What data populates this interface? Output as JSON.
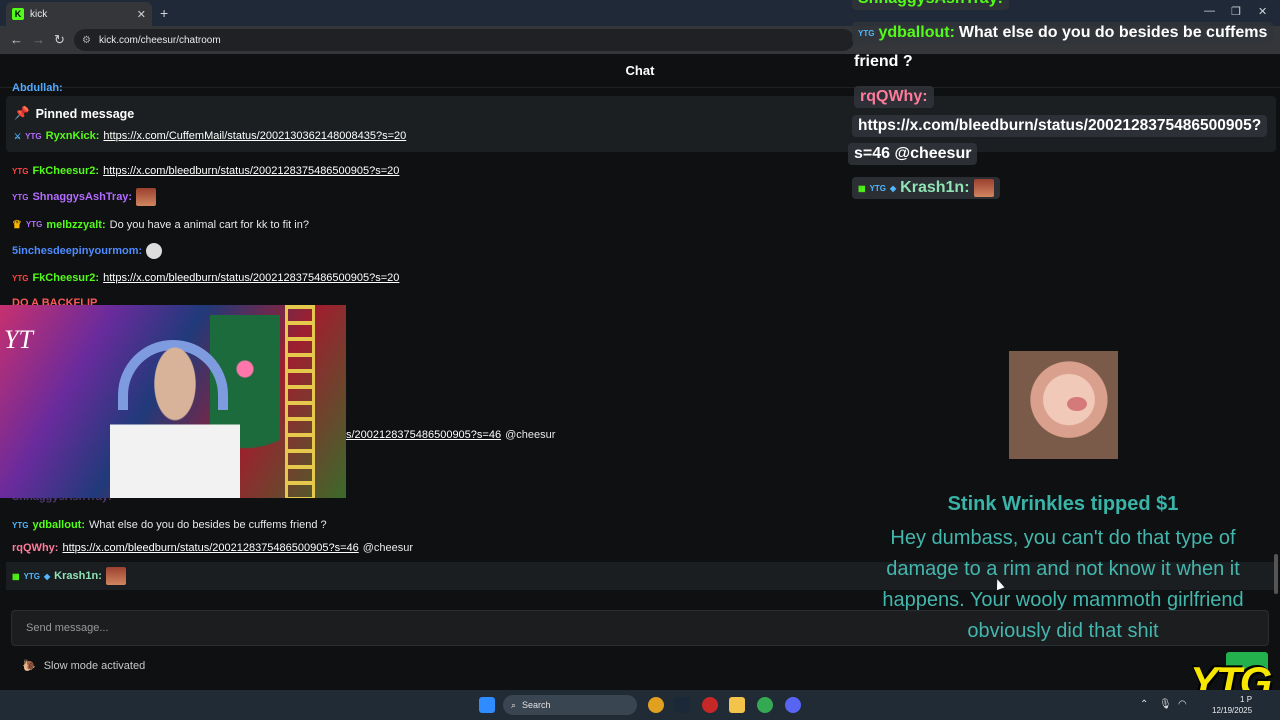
{
  "browser": {
    "tab_title": "kick",
    "tab_icon": "K",
    "new_tab": "+",
    "url": "kick.com/cheesur/chatroom"
  },
  "chat": {
    "header": "Chat",
    "cut_name": "Abdullah:",
    "pinned": {
      "title": "Pinned message",
      "user": "RyxnKick:",
      "text": "https://x.com/CuffemMail/status/2002130362148008435?s=20"
    },
    "messages": [
      {
        "user": "FkCheesur2:",
        "text": "https://x.com/bleedburn/status/2002128375486500905?s=20"
      },
      {
        "user": "ShnaggysAshTray:",
        "text": ""
      },
      {
        "user": "melbzzyalt:",
        "text": "Do you have a animal cart for kk to fit in?"
      },
      {
        "user": "5inchesdeepinyourmom:",
        "text": ""
      },
      {
        "user": "FkCheesur2:",
        "text": "https://x.com/bleedburn/status/2002128375486500905?s=20"
      },
      {
        "user": "ShnaggysAshTray:",
        "text": ""
      },
      {
        "user": "ydballout:",
        "text": "What else do you do besides be cuffems friend ?"
      },
      {
        "user": "rqQWhy:",
        "text": "https://x.com/bleedburn/status/2002128375486500905?s=46",
        "mention": "@cheesur"
      },
      {
        "user": "Krash1n:",
        "text": ""
      }
    ],
    "partial_line": {
      "text": "s/2002128375486500905?s=46",
      "mention": "@cheesur"
    },
    "partial_top": "DO A BACKFLIP",
    "send_placeholder": "Send message...",
    "slow_mode": "Slow mode activated"
  },
  "overlay": {
    "line0": "ShnaggysAshTray:",
    "line1_user": "ydballout:",
    "line1_text": "What else do you do besides be cuffems",
    "line1_cont": "friend ?",
    "line2_user": "rqQWhy:",
    "line2_text": "https://x.com/bleedburn/status/2002128375486500905?",
    "line2_cont": "s=46 @cheesur",
    "line3_user": "Krash1n:"
  },
  "tip": {
    "title": "Stink Wrinkles tipped $1",
    "message": "Hey dumbass, you can't do that type of damage to a rim and not know it when it happens. Your wooly mammoth girlfriend obviously did that shit"
  },
  "watermark": "YTG",
  "taskbar": {
    "search": "Search",
    "time": "1 P",
    "date": "12/19/2025"
  },
  "colors": {
    "kick_green": "#53fc18",
    "tip_teal": "#3ab3a8",
    "ytg_yellow": "#f6e600"
  }
}
